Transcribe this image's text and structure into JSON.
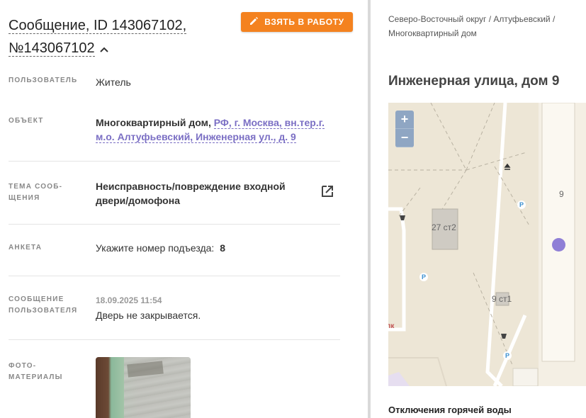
{
  "message": {
    "title": "Сообщение, ID 143067102, №143067102",
    "take_button": "ВЗЯТЬ В РАБОТУ"
  },
  "fields": {
    "user": {
      "label": "ПОЛЬЗОВАТЕЛЬ",
      "value": "Житель"
    },
    "object": {
      "label": "ОБЪЕКТ",
      "type": "Многоквартирный дом,",
      "address": "РФ, г. Москва, вн.тер.г. м.о. Алтуфьевский, Инженерная ул., д. 9"
    },
    "topic": {
      "label": "ТЕМА СООБ­ЩЕНИЯ",
      "value": "Неисправность/повреждение входной двери/домофона"
    },
    "survey": {
      "label": "АНКЕТА",
      "question": "Укажите номер подъезда:",
      "answer": "8"
    },
    "user_message": {
      "label": "СООБЩЕНИЕ ПОЛЬЗОВАТЕЛЯ",
      "date": "18.09.2025 11:54",
      "text": "Дверь не закрывается."
    },
    "photos": {
      "label": "ФОТО­МАТЕРИАЛЫ"
    }
  },
  "sidebar": {
    "breadcrumb": "Северо-Восточный округ / Алтуфьевский / Многоквартирный дом",
    "address": "Инженерная улица, дом 9",
    "map": {
      "zoom_in": "+",
      "zoom_out": "−",
      "labels": {
        "building_27": "27 ст2",
        "building_9st1": "9 ст1",
        "building_9": "9",
        "parking": "P",
        "street_fragment": "лк"
      }
    },
    "outage_title": "Отключения горячей воды"
  },
  "colors": {
    "accent": "#f4821f",
    "link": "#7b6fc4",
    "marker": "#8f7fd6"
  }
}
